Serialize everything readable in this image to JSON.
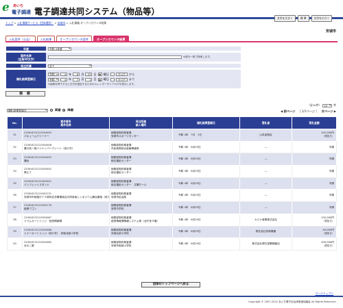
{
  "header": {
    "logo_mark": "e",
    "logo_top": "あいち",
    "logo_bottom": "電子調達",
    "app_title": "電子調達共同システム（物品等）",
    "font_buttons": [
      "文字を大きく",
      "標 準",
      "文字を小さく"
    ]
  },
  "breadcrumb": {
    "items": [
      "トップ",
      "入札情報サービス（団体選択）",
      "安城市"
    ],
    "current": "入札情報-オープンカウンタ結果",
    "separator": " > "
  },
  "organization": "安城市",
  "tabs": [
    {
      "label": "入札案件（公告）",
      "active": false
    },
    {
      "label": "入札結果",
      "active": false
    },
    {
      "label": "オープンカウンタ案件",
      "active": false
    },
    {
      "label": "オープンカウンタ結果",
      "active": true
    }
  ],
  "search": {
    "year_label": "年度",
    "year_value": "令和 4年度",
    "item_name_label": "案件名称",
    "item_name_sub": "（全角50文字）",
    "item_name_value": "",
    "item_name_note": "※部分一致で検索します。",
    "dept_label": "発注所属",
    "dept_value": "全て",
    "date_label": "開札結果登録日",
    "date_from": {
      "era": "令和",
      "year": "4",
      "y": "年",
      "month": "6",
      "m": "月",
      "day": "23",
      "d": "日",
      "suffix": "から"
    },
    "date_to": {
      "era": "令和",
      "year": "4",
      "y": "年",
      "month": "7",
      "m": "月",
      "day": "1",
      "d": "日",
      "suffix": "まで"
    },
    "calendar_glyph": "▦",
    "weekday_label": "曜日",
    "clear_label": "クリア",
    "date_note": "※画像を押下すると日付を指定するためのカレンダーダイアログを表示します。",
    "search_button": "検 索"
  },
  "sort": {
    "field": "開札結果登録日",
    "asc_label": "昇順",
    "desc_label": "降順",
    "selected": "desc"
  },
  "pager": {
    "page_info": "（全10件）",
    "page_size": "10",
    "page_size_suffix": "件",
    "prev_label": "◀ 前ページ",
    "page_indicator": "［ 1/1ページ ］",
    "next_label": "次ページ ▶"
  },
  "table": {
    "headers": {
      "no": "No.",
      "name_line1": "案件番号",
      "name_line2": "案件名称",
      "dept_line1": "発注所属",
      "dept_line2": "納入場所",
      "date": "開札結果登録日",
      "winner": "落札者",
      "price": "落札金額"
    },
    "rows": [
      {
        "no": "31",
        "code": "220616232120054603",
        "name": "パキュームクリーナー",
        "dept": "総務部契約検査課",
        "place": "安城市スポーツセンター",
        "date": "令和 4年　7月　1日",
        "winner": "山本金物店",
        "price": "102,000円",
        "tax": "（税抜き）"
      },
      {
        "no": "32",
        "code": "220616232120054608",
        "name": "書分析一般バイナンバープレート（他２件）",
        "dept": "総務部契約検査課",
        "place": "市民病院総合医療情報係",
        "date": "令和 4年　6月29日",
        "winner": "―",
        "price": "不調",
        "tax": ""
      },
      {
        "no": "33",
        "date": "令和 4年　6月29日",
        "code": "220616232120054653",
        "name": "講台",
        "dept": "総務部契約検査課",
        "place": "総合福祉センター",
        "winner": "―",
        "price": "不調",
        "tax": ""
      },
      {
        "no": "34",
        "code": "220616232120054652",
        "name": "車止て",
        "dept": "総務部契約検査課",
        "place": "総合福祉センター",
        "date": "令和 4年　6月29日",
        "winner": "―",
        "price": "不調",
        "tax": ""
      },
      {
        "no": "35",
        "code": "220616232120054651",
        "name": "パンフレットスタンド",
        "dept": "総務部契約検査課",
        "place": "総合福祉センター　文閣ホール",
        "date": "令和 4年　6月29日",
        "winner": "―",
        "price": "不調",
        "tax": ""
      },
      {
        "no": "36",
        "code": "220616232120054701",
        "name": "安城市市制施行７５周年記念事業南吉共同参画シンポジウム舞台看板（他１件）",
        "dept": "総務部契約検査課",
        "place": "安城市民会館",
        "date": "令和 4年　6月29日",
        "winner": "―",
        "price": "不調",
        "tax": ""
      },
      {
        "no": "37",
        "code": "220616232120054776",
        "name": "絵巻ワゴン",
        "dept": "総務部契約検査課",
        "place": "安祥中学校",
        "date": "令和 4年　6月29日",
        "winner": "―",
        "price": "不調",
        "tax": ""
      },
      {
        "no": "38",
        "code": "220616232120054667",
        "name": "ドラムカートリッジ　経営情報課",
        "dept": "総務部契約検査課",
        "place": "経営情報課情報システム係（北庁舎４階）",
        "date": "令和 4年　6月29日",
        "winner": "カミヤ産業株式会社",
        "price": "132,000円",
        "tax": "（税抜き）"
      },
      {
        "no": "39",
        "code": "220616232120054666",
        "name": "トナーカートリッジ（他２件）　安城北部小学校",
        "dept": "総務部契約検査課",
        "place": "安城北部小学校",
        "date": "令和 4年　6月29日",
        "winner": "株式会社安城電機",
        "price": "40,000円",
        "tax": "（税抜き）"
      },
      {
        "no": "40",
        "code": "220616232120054665",
        "name": "あのこ屋",
        "dept": "総務部契約検査課",
        "place": "安城市南部小学校",
        "date": "令和 4年　6月29日",
        "winner": "株式会社博文堂事務機店",
        "price": "435,000円",
        "tax": "（税抜き）"
      }
    ]
  },
  "back_button": "団体のトップページへ戻る",
  "page_top": "ページトップへ",
  "copyright": "Copyright © 2007-2022 あいち電子自治体推進協議会 All Rights Reserved."
}
